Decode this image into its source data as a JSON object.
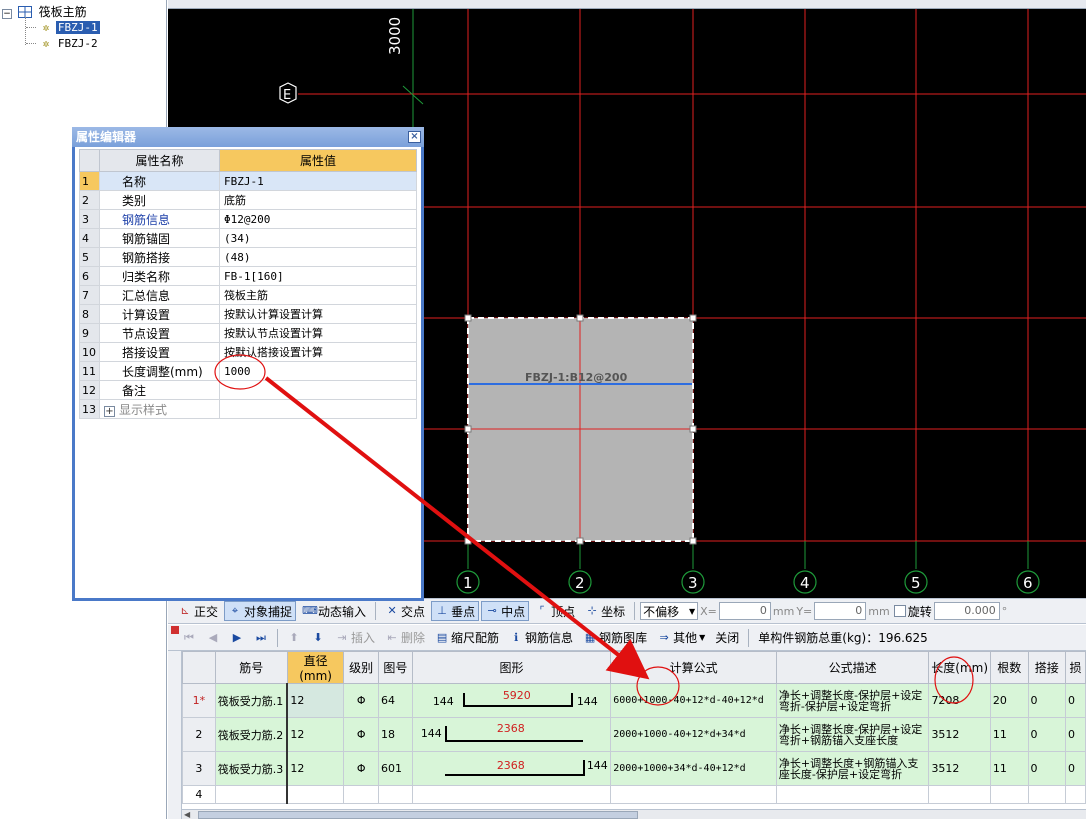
{
  "tree": {
    "root": "筏板主筋",
    "items": [
      "FBZJ-1",
      "FBZJ-2"
    ]
  },
  "canvas": {
    "dim_text": "3000",
    "axis_row_label": "E",
    "axis_col_labels": [
      "1",
      "2",
      "3",
      "4",
      "5",
      "6"
    ],
    "slab_label": "FBZJ-1:B12@200",
    "colors": {
      "grid_red": "#e02020",
      "grid_green": "#1e9a3a",
      "slab_fill": "#b4b4b4",
      "rebar_blue": "#2d6de0"
    }
  },
  "prop_editor": {
    "title": "属性编辑器",
    "close": "×",
    "col_name": "属性名称",
    "col_value": "属性值",
    "rows": [
      {
        "n": "1",
        "name": "名称",
        "value": "FBZJ-1"
      },
      {
        "n": "2",
        "name": "类别",
        "value": "底筋"
      },
      {
        "n": "3",
        "name": "钢筋信息",
        "value": "Φ12@200"
      },
      {
        "n": "4",
        "name": "钢筋锚固",
        "value": "(34)"
      },
      {
        "n": "5",
        "name": "钢筋搭接",
        "value": "(48)"
      },
      {
        "n": "6",
        "name": "归类名称",
        "value": "FB-1[160]"
      },
      {
        "n": "7",
        "name": "汇总信息",
        "value": "筏板主筋"
      },
      {
        "n": "8",
        "name": "计算设置",
        "value": "按默认计算设置计算"
      },
      {
        "n": "9",
        "name": "节点设置",
        "value": "按默认节点设置计算"
      },
      {
        "n": "10",
        "name": "搭接设置",
        "value": "按默认搭接设置计算"
      },
      {
        "n": "11",
        "name": "长度调整(mm)",
        "value": "1000"
      },
      {
        "n": "12",
        "name": "备注",
        "value": ""
      },
      {
        "n": "13",
        "name": "显示样式",
        "value": ""
      }
    ],
    "expand": "+"
  },
  "snap_toolbar": {
    "ortho": "正交",
    "object_snap": "对象捕捉",
    "dynamic_input": "动态输入",
    "intersection": "交点",
    "perpendicular": "垂点",
    "midpoint": "中点",
    "vertex": "顶点",
    "coordinate": "坐标",
    "offset_select": "不偏移",
    "x_label": "X=",
    "x_value": "0",
    "y_label": "Y=",
    "y_value": "0",
    "mm": "mm",
    "rotate": "旋转",
    "rotate_value": "0.000",
    "degree": "°"
  },
  "rebar_toolbar": {
    "insert": "插入",
    "delete": "删除",
    "scale_rebar": "缩尺配筋",
    "rebar_info": "钢筋信息",
    "rebar_library": "钢筋图库",
    "other": "其他",
    "close": "关闭",
    "total_weight": "单构件钢筋总重(kg)：196.625"
  },
  "rebar_grid": {
    "headers": [
      "筋号",
      "直径(mm)",
      "级别",
      "图号",
      "图形",
      "计算公式",
      "公式描述",
      "长度(mm)",
      "根数",
      "搭接",
      "损"
    ],
    "rows": [
      {
        "rn": "1*",
        "name": "筏板受力筋.1",
        "dia": "12",
        "grade": "Φ",
        "fig": "64",
        "left": "144",
        "mid": "5920",
        "right": "144",
        "formula": "6000+1000-40+12*d-40+12*d",
        "desc": "净长+调整长度-保护层+设定弯折-保护层+设定弯折",
        "length": "7208",
        "count": "20",
        "lap": "0",
        "loss": "0"
      },
      {
        "rn": "2",
        "name": "筏板受力筋.2",
        "dia": "12",
        "grade": "Φ",
        "fig": "18",
        "left": "144",
        "mid": "2368",
        "right": "",
        "formula": "2000+1000-40+12*d+34*d",
        "desc": "净长+调整长度-保护层+设定弯折+钢筋锚入支座长度",
        "length": "3512",
        "count": "11",
        "lap": "0",
        "loss": "0"
      },
      {
        "rn": "3",
        "name": "筏板受力筋.3",
        "dia": "12",
        "grade": "Φ",
        "fig": "601",
        "left": "",
        "mid": "2368",
        "right": "144",
        "formula": "2000+1000+34*d-40+12*d",
        "desc": "净长+调整长度+钢筋锚入支座长度-保护层+设定弯折",
        "length": "3512",
        "count": "11",
        "lap": "0",
        "loss": "0"
      },
      {
        "rn": "4",
        "name": "",
        "dia": "",
        "grade": "",
        "fig": "",
        "left": "",
        "mid": "",
        "right": "",
        "formula": "",
        "desc": "",
        "length": "",
        "count": "",
        "lap": "",
        "loss": ""
      }
    ]
  }
}
